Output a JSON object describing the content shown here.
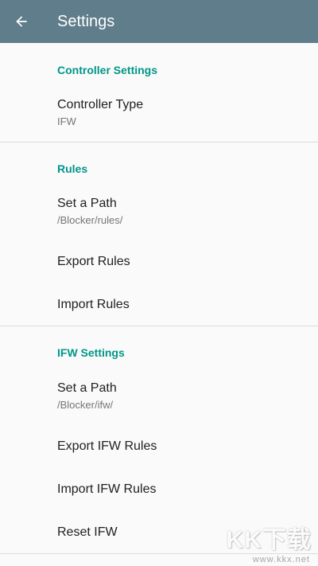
{
  "toolbar": {
    "title": "Settings",
    "back_icon": "arrow-left-icon",
    "background_color": "#607d8b"
  },
  "sections": {
    "controller": {
      "header": "Controller Settings",
      "controller_type": {
        "title": "Controller Type",
        "summary": "IFW"
      }
    },
    "rules": {
      "header": "Rules",
      "set_path": {
        "title": "Set a Path",
        "summary": "/Blocker/rules/"
      },
      "export": {
        "title": "Export Rules"
      },
      "import": {
        "title": "Import Rules"
      }
    },
    "ifw": {
      "header": "IFW Settings",
      "set_path": {
        "title": "Set a Path",
        "summary": "/Blocker/ifw/"
      },
      "export": {
        "title": "Export IFW Rules"
      },
      "import": {
        "title": "Import IFW Rules"
      },
      "reset": {
        "title": "Reset IFW"
      }
    }
  },
  "accent_color": "#009688",
  "watermark": {
    "logo": "KK下载",
    "url": "www.kkx.net"
  }
}
